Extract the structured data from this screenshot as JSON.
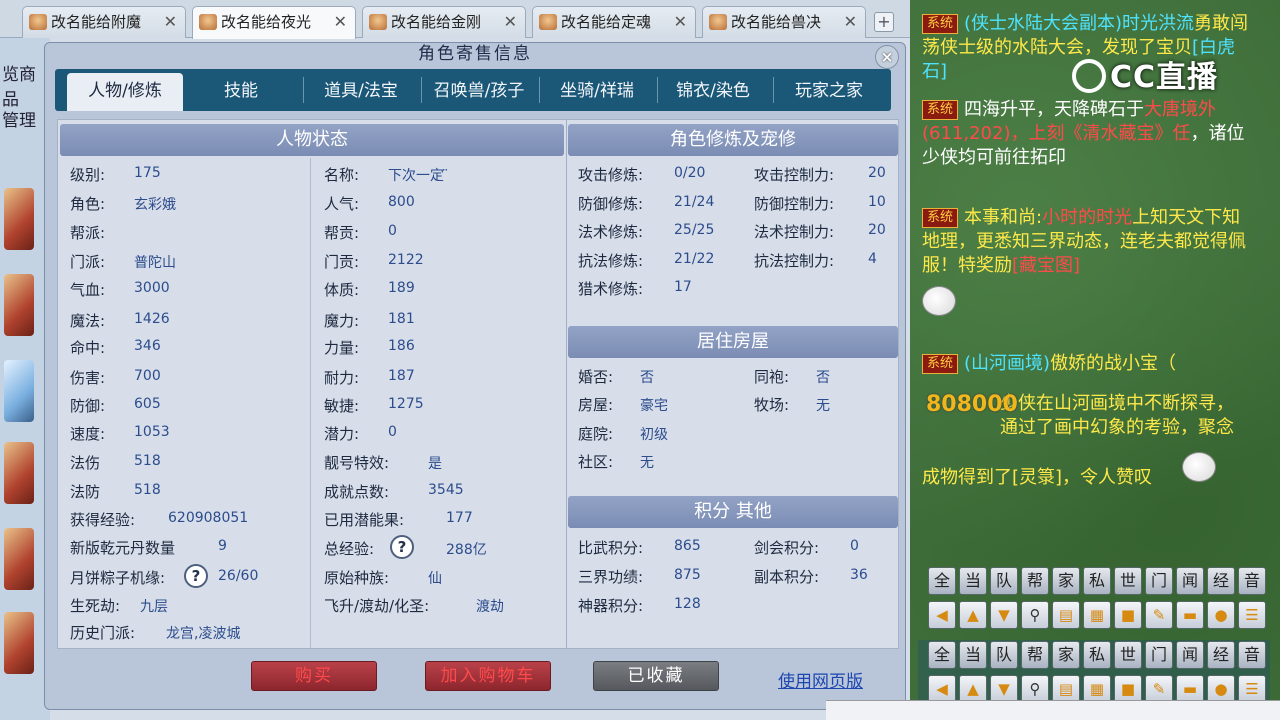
{
  "browser_tabs": [
    {
      "label": "改名能给附魔"
    },
    {
      "label": "改名能给夜光"
    },
    {
      "label": "改名能给金刚"
    },
    {
      "label": "改名能给定魂"
    },
    {
      "label": "改名能给兽决"
    }
  ],
  "new_tab": "+",
  "bg_left": {
    "line1": "览商品",
    "line2": "管理"
  },
  "modal": {
    "title": "角色寄售信息",
    "close": "×",
    "tabs": [
      {
        "label": "人物/修炼"
      },
      {
        "label": "技能"
      },
      {
        "label": "道具/法宝"
      },
      {
        "label": "召唤兽/孩子"
      },
      {
        "label": "坐骑/祥瑞"
      },
      {
        "label": "锦衣/染色"
      },
      {
        "label": "玩家之家"
      }
    ],
    "status_head": "人物状态",
    "status_left": [
      {
        "label": "级别:",
        "value": "175"
      },
      {
        "label": "角色:",
        "value": "玄彩娥"
      },
      {
        "label": "帮派:",
        "value": ""
      },
      {
        "label": "门派:",
        "value": "普陀山"
      },
      {
        "label": "气血:",
        "value": "3000"
      },
      {
        "label": "魔法:",
        "value": "1426"
      },
      {
        "label": "命中:",
        "value": "346"
      },
      {
        "label": "伤害:",
        "value": "700"
      },
      {
        "label": "防御:",
        "value": "605"
      },
      {
        "label": "速度:",
        "value": "1053"
      },
      {
        "label": "法伤",
        "value": "518"
      },
      {
        "label": "法防",
        "value": "518"
      },
      {
        "label": "获得经验:",
        "value": "620908051"
      },
      {
        "label": "新版乾元丹数量",
        "value": "9"
      },
      {
        "label": "月饼粽子机缘:",
        "value": "26/60"
      },
      {
        "label": "生死劫:",
        "value": "九层"
      },
      {
        "label": "历史门派:",
        "value": "龙宫,凌波城"
      }
    ],
    "status_right": [
      {
        "label": "名称:",
        "value": "下次一定 ̈"
      },
      {
        "label": "人气:",
        "value": "800"
      },
      {
        "label": "帮贡:",
        "value": "0"
      },
      {
        "label": "门贡:",
        "value": "2122"
      },
      {
        "label": "体质:",
        "value": "189"
      },
      {
        "label": "魔力:",
        "value": "181"
      },
      {
        "label": "力量:",
        "value": "186"
      },
      {
        "label": "耐力:",
        "value": "187"
      },
      {
        "label": "敏捷:",
        "value": "1275"
      },
      {
        "label": "潜力:",
        "value": "0"
      },
      {
        "label": "靓号特效:",
        "value": "是"
      },
      {
        "label": "成就点数:",
        "value": "3545"
      },
      {
        "label": "已用潜能果:",
        "value": "177"
      },
      {
        "label": "总经验:",
        "value": "288亿"
      },
      {
        "label": "原始种族:",
        "value": "仙"
      },
      {
        "label": "飞升/渡劫/化圣:",
        "value": "渡劫"
      }
    ],
    "help": "?",
    "cultivation_head": "角色修炼及宠修",
    "cultivation": [
      {
        "l1": "攻击修炼:",
        "v1": "0/20",
        "l2": "攻击控制力:",
        "v2": "20"
      },
      {
        "l1": "防御修炼:",
        "v1": "21/24",
        "l2": "防御控制力:",
        "v2": "10"
      },
      {
        "l1": "法术修炼:",
        "v1": "25/25",
        "l2": "法术控制力:",
        "v2": "20"
      },
      {
        "l1": "抗法修炼:",
        "v1": "21/22",
        "l2": "抗法控制力:",
        "v2": "4"
      },
      {
        "l1": "猎术修炼:",
        "v1": "17",
        "l2": "",
        "v2": ""
      }
    ],
    "house_head": "居住房屋",
    "house": [
      {
        "l1": "婚否:",
        "v1": "否",
        "l2": "同袍:",
        "v2": "否"
      },
      {
        "l1": "房屋:",
        "v1": "豪宅",
        "l2": "牧场:",
        "v2": "无"
      },
      {
        "l1": "庭院:",
        "v1": "初级",
        "l2": "",
        "v2": ""
      },
      {
        "l1": "社区:",
        "v1": "无",
        "l2": "",
        "v2": ""
      }
    ],
    "score_head": "积分 其他",
    "score": [
      {
        "l1": "比武积分:",
        "v1": "865",
        "l2": "剑会积分:",
        "v2": "0"
      },
      {
        "l1": "三界功绩:",
        "v1": "875",
        "l2": "副本积分:",
        "v2": "36"
      },
      {
        "l1": "神器积分:",
        "v1": "128",
        "l2": "",
        "v2": ""
      }
    ],
    "buttons": {
      "buy": "购买",
      "cart": "加入购物车",
      "fav": "已收藏",
      "web": "使用网页版"
    }
  },
  "chat": {
    "logo": "CC直播",
    "sys": "系统",
    "m1a": "(侠士水陆大会副本)时光洪流",
    "m1b": "勇敢闯荡侠士级的水陆大会，发现了宝贝",
    "m1c": "[白虎石]",
    "m2a": "四海升平，天降碑石于",
    "m2b": "大唐境外(611,202)",
    "m2c": "，上刻《清水藏宝》任",
    "m2d": "，诸位少侠均可前往拓印",
    "m3a": "本事和尚:",
    "m3b": "小时的时光",
    "m3c": "上知天文下知地理，更悉知三界动态，连老夫都觉得佩服！特奖励",
    "m3d": "[藏宝图]",
    "m4a": "(山河画境)",
    "m4b": "傲娇的战小宝（",
    "m4nums": "808000",
    "m4c": "少侠在山河画境中不断探寻，通过了画中幻象的考验，聚念",
    "m4d": "成物得到了[灵箓]，令人赞叹",
    "channels": [
      "全",
      "当",
      "队",
      "帮",
      "家",
      "私",
      "世",
      "门",
      "闻",
      "经",
      "音"
    ]
  }
}
